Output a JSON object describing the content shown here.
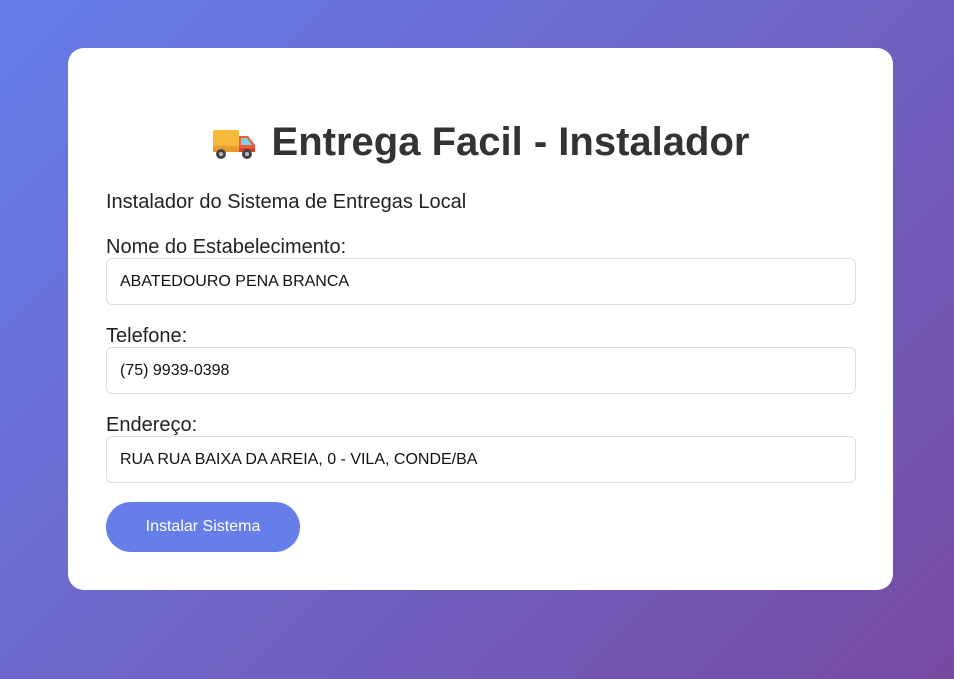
{
  "header": {
    "icon": "delivery-truck-icon",
    "title": "Entrega Facil - Instalador"
  },
  "subtitle": "Instalador do Sistema de Entregas Local",
  "form": {
    "business_name": {
      "label": "Nome do Estabelecimento:",
      "value": "ABATEDOURO PENA BRANCA"
    },
    "phone": {
      "label": "Telefone:",
      "value": "(75) 9939-0398"
    },
    "address": {
      "label": "Endereço:",
      "value": "RUA RUA BAIXA DA AREIA, 0 - VILA, CONDE/BA"
    },
    "submit_label": "Instalar Sistema"
  },
  "colors": {
    "gradient_start": "#667eea",
    "gradient_end": "#764ba2",
    "button": "#667eea",
    "title": "#333333"
  }
}
